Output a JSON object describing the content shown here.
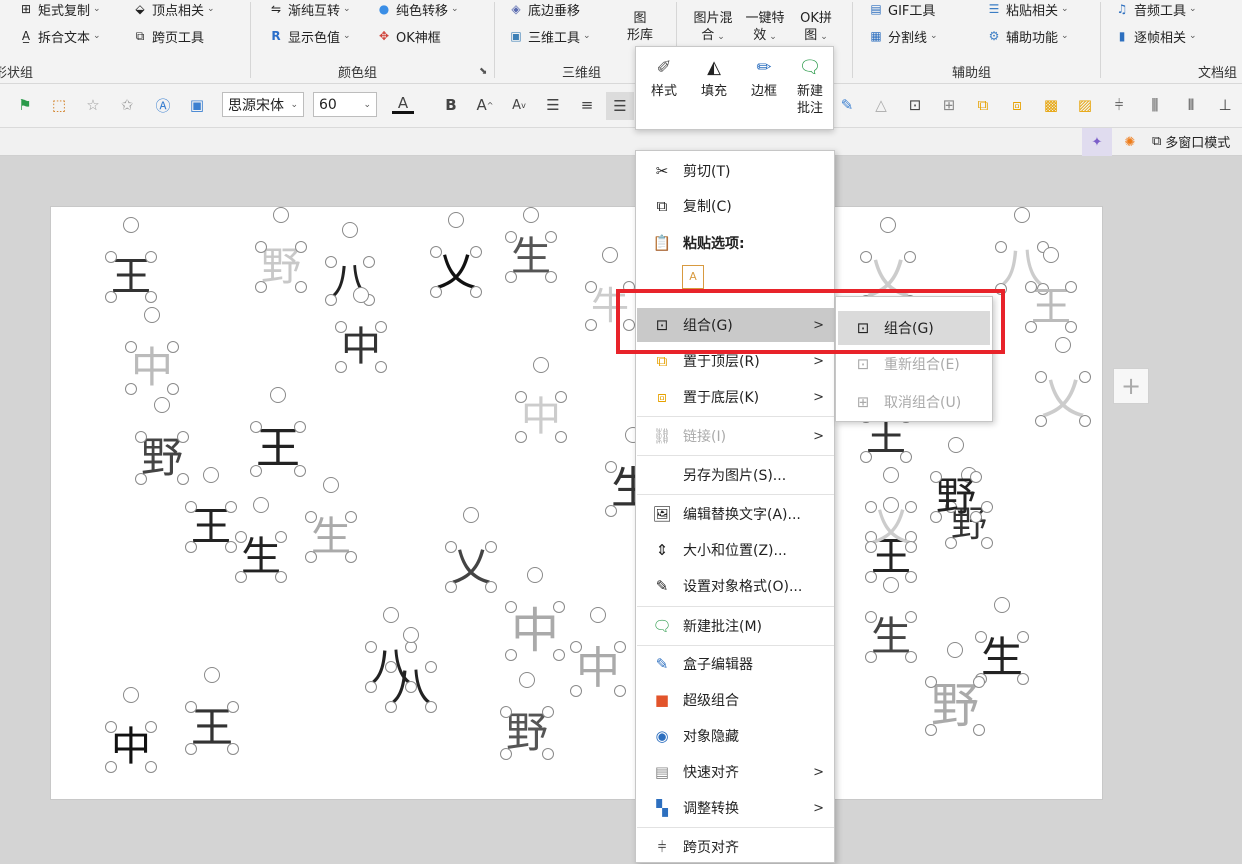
{
  "ribbon": {
    "row1": [
      "矩式复制",
      "顶点相关",
      "渐纯互转",
      "纯色转移",
      "底边垂移",
      "GIF工具",
      "粘贴相关",
      "音频工具"
    ],
    "row2": [
      "拆合文本",
      "跨页工具",
      "显示色值",
      "OK神框",
      "三维工具",
      "分割线",
      "辅助功能",
      "逐帧相关"
    ],
    "tall": {
      "tuku1": "图",
      "tuku2": "形库",
      "hunhe1": "图片混",
      "hunhe2": "合",
      "yijian1": "一键特",
      "yijian2": "效",
      "okpin1": "OK拼",
      "okpin2": "图"
    },
    "groups": {
      "shape": "形状组",
      "color": "颜色组",
      "threed": "三维组",
      "aux": "辅助组",
      "doc": "文档组"
    }
  },
  "format_bar": {
    "font": "思源宋体",
    "size": "60",
    "bold": "B",
    "grow": "A",
    "shrink": "A"
  },
  "sub_bar": {
    "multiwin": "多窗口模式"
  },
  "mini_toolbar": [
    "样式",
    "填充",
    "边框",
    "新建",
    "批注"
  ],
  "context_menu": {
    "cut": "剪切(T)",
    "copy": "复制(C)",
    "paste_header": "粘贴选项:",
    "group": "组合(G)",
    "bring_front": "置于顶层(R)",
    "send_back": "置于底层(K)",
    "link": "链接(I)",
    "save_picture": "另存为图片(S)...",
    "alt_text": "编辑替换文字(A)...",
    "size_pos": "大小和位置(Z)...",
    "format_obj": "设置对象格式(O)...",
    "new_comment": "新建批注(M)",
    "box_editor": "盒子编辑器",
    "super_group": "超级组合",
    "hide_obj": "对象隐藏",
    "quick_align": "快速对齐",
    "adjust_convert": "调整转换",
    "page_align": "跨页对齐"
  },
  "submenu": {
    "group": "组合(G)",
    "regroup": "重新组合(E)",
    "ungroup": "取消组合(U)"
  },
  "slide_chars": [
    "王",
    "野",
    "八",
    "乂",
    "生",
    "牛",
    "中",
    "王",
    "野",
    "生",
    "乂",
    "中",
    "八",
    "王",
    "生",
    "野",
    "中",
    "乂",
    "八",
    "王",
    "生",
    "野",
    "王",
    "野",
    "乂",
    "生",
    "中",
    "中",
    "王",
    "生",
    "乂",
    "八",
    "王",
    "野",
    "中"
  ],
  "colors": {
    "highlight": "#e8232a",
    "menu_hover": "#c9c9c9",
    "handle": "#8a8a8a"
  }
}
